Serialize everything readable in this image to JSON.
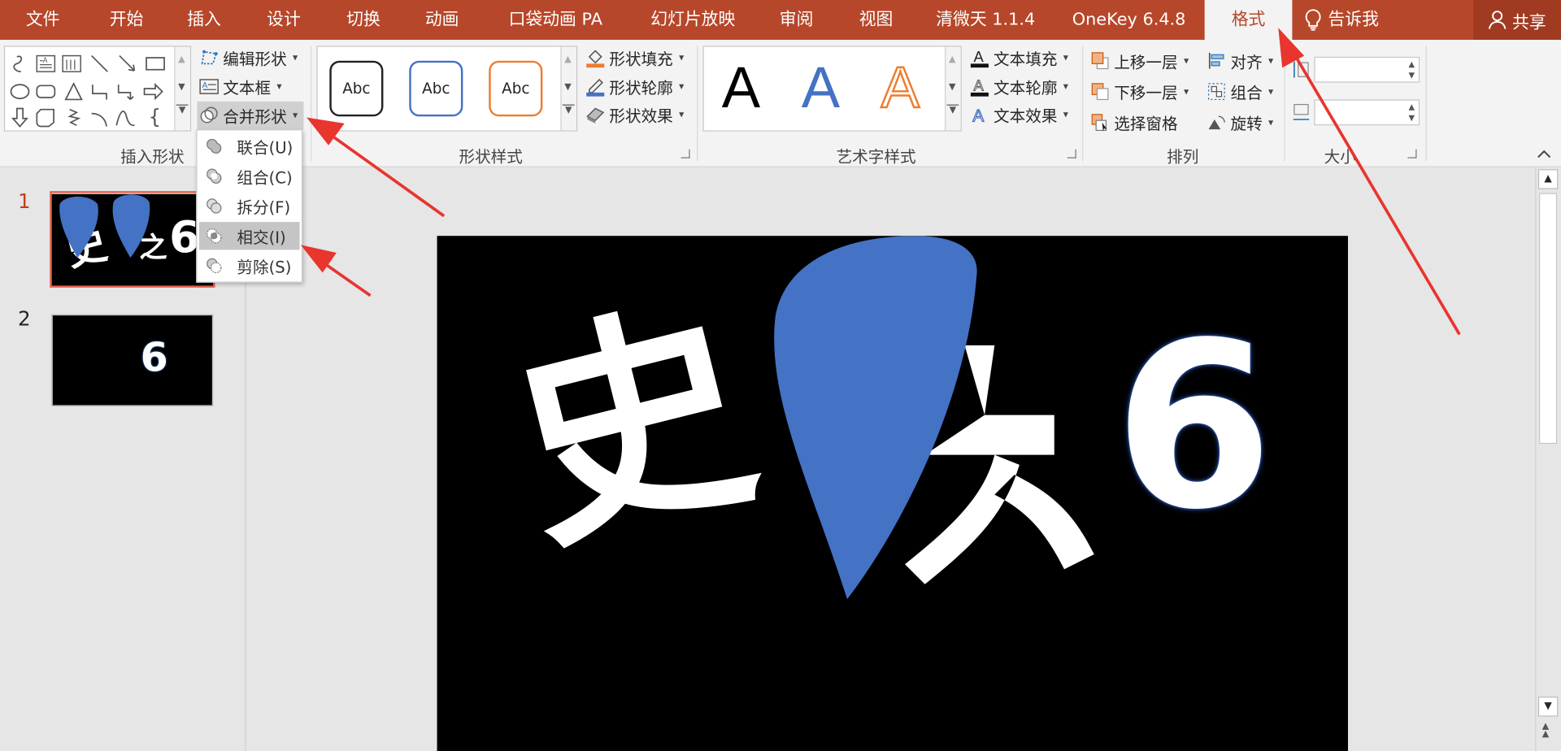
{
  "tabs": [
    "文件",
    "开始",
    "插入",
    "设计",
    "切换",
    "动画",
    "口袋动画 PA",
    "幻灯片放映",
    "审阅",
    "视图",
    "清微天 1.1.4",
    "OneKey 6.4.8",
    "格式"
  ],
  "active_tab": "格式",
  "tell_me": "告诉我",
  "share": "共享",
  "insert_shapes": {
    "label": "插入形状",
    "edit_shape": "编辑形状",
    "text_box": "文本框",
    "merge_shapes": "合并形状"
  },
  "shape_styles": {
    "label": "形状样式",
    "samples": [
      "Abc",
      "Abc",
      "Abc"
    ],
    "fill": "形状填充",
    "outline": "形状轮廓",
    "effects": "形状效果"
  },
  "wordart_styles": {
    "label": "艺术字样式",
    "samples": [
      "A",
      "A",
      "A"
    ],
    "text_fill": "文本填充",
    "text_outline": "文本轮廓",
    "text_effects": "文本效果"
  },
  "arrange": {
    "label": "排列",
    "bring_forward": "上移一层",
    "send_backward": "下移一层",
    "selection_pane": "选择窗格",
    "align": "对齐",
    "group": "组合",
    "rotate": "旋转"
  },
  "size": {
    "label": "大小",
    "height_value": "",
    "width_value": ""
  },
  "merge_menu": {
    "items": [
      "联合(U)",
      "组合(C)",
      "拆分(F)",
      "相交(I)",
      "剪除(S)"
    ],
    "highlighted": "相交(I)"
  },
  "slides": [
    {
      "number": "1",
      "text_left": "史",
      "text_right": "6"
    },
    {
      "number": "2",
      "text_right": "6"
    }
  ],
  "slide_content": {
    "char_left": "史",
    "char_right": "6"
  },
  "colors": {
    "tab_bar": "#b7472a",
    "shape_blue": "#4472c4",
    "arrow_red": "#e8352e",
    "outline_orange": "#ed7d31"
  }
}
